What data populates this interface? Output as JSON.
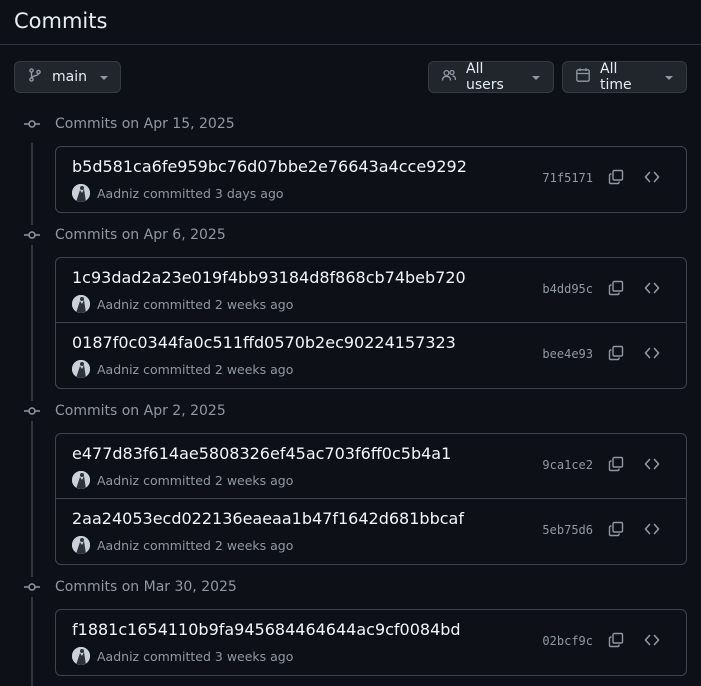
{
  "header": {
    "title": "Commits"
  },
  "toolbar": {
    "branch_label": "main",
    "users_label": "All users",
    "time_label": "All time"
  },
  "groups": [
    {
      "title": "Commits on Apr 15, 2025",
      "commits": [
        {
          "message": "b5d581ca6fe959bc76d07bbe2e76643a4cce9292",
          "author": "Aadniz",
          "action": "committed",
          "when": "3 days ago",
          "sha": "71f5171"
        }
      ]
    },
    {
      "title": "Commits on Apr 6, 2025",
      "commits": [
        {
          "message": "1c93dad2a23e019f4bb93184d8f868cb74beb720",
          "author": "Aadniz",
          "action": "committed",
          "when": "2 weeks ago",
          "sha": "b4dd95c"
        },
        {
          "message": "0187f0c0344fa0c511ffd0570b2ec90224157323",
          "author": "Aadniz",
          "action": "committed",
          "when": "2 weeks ago",
          "sha": "bee4e93"
        }
      ]
    },
    {
      "title": "Commits on Apr 2, 2025",
      "commits": [
        {
          "message": "e477d83f614ae5808326ef45ac703f6ff0c5b4a1",
          "author": "Aadniz",
          "action": "committed",
          "when": "2 weeks ago",
          "sha": "9ca1ce2"
        },
        {
          "message": "2aa24053ecd022136eaeaa1b47f1642d681bbcaf",
          "author": "Aadniz",
          "action": "committed",
          "when": "2 weeks ago",
          "sha": "5eb75d6"
        }
      ]
    },
    {
      "title": "Commits on Mar 30, 2025",
      "commits": [
        {
          "message": "f1881c1654110b9fa945684464644ac9cf0084bd",
          "author": "Aadniz",
          "action": "committed",
          "when": "3 weeks ago",
          "sha": "02bcf9c"
        }
      ]
    }
  ],
  "icons": {
    "branch": "git-branch-icon",
    "users": "people-icon",
    "calendar": "calendar-icon",
    "commit": "git-commit-icon",
    "copy": "copy-icon",
    "browse": "code-icon"
  }
}
